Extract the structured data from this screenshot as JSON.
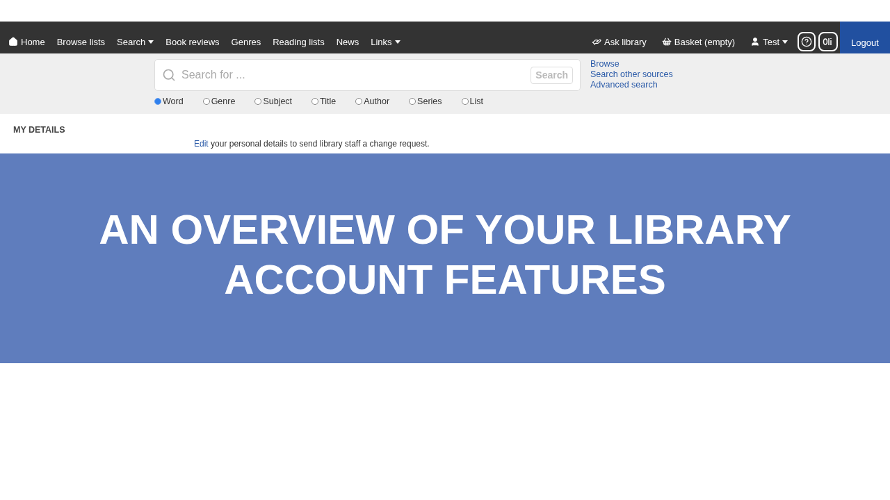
{
  "nav": {
    "items": [
      {
        "label": "Home",
        "kind": "home"
      },
      {
        "label": "Browse lists",
        "kind": "plain"
      },
      {
        "label": "Search",
        "kind": "menu"
      },
      {
        "label": "Book reviews",
        "kind": "plain"
      },
      {
        "label": "Genres",
        "kind": "plain"
      },
      {
        "label": "Reading lists",
        "kind": "plain"
      },
      {
        "label": "News",
        "kind": "plain"
      },
      {
        "label": "Links",
        "kind": "menu"
      }
    ],
    "right_items": [
      {
        "label": "Ask library",
        "kind": "ask"
      },
      {
        "label": "Basket (empty)",
        "kind": "basket"
      },
      {
        "label": "Test",
        "kind": "user"
      }
    ],
    "logout": "Logout"
  },
  "search": {
    "placeholder": "Search for ...",
    "button": "Search",
    "options": [
      {
        "label": "Word",
        "selected": true
      },
      {
        "label": "Genre",
        "selected": false
      },
      {
        "label": "Subject",
        "selected": false
      },
      {
        "label": "Title",
        "selected": false
      },
      {
        "label": "Author",
        "selected": false
      },
      {
        "label": "Series",
        "selected": false
      },
      {
        "label": "List",
        "selected": false
      }
    ],
    "links": [
      "Browse",
      "Search other sources",
      "Advanced search"
    ]
  },
  "sidebar": {
    "title": "MY DETAILS"
  },
  "main": {
    "edit_link": "Edit",
    "edit_text": "your personal details to send library staff a change request."
  },
  "banner": {
    "title_lines": [
      "AN OVERVIEW OF YOUR LIBRARY",
      "ACCOUNT FEATURES"
    ]
  }
}
